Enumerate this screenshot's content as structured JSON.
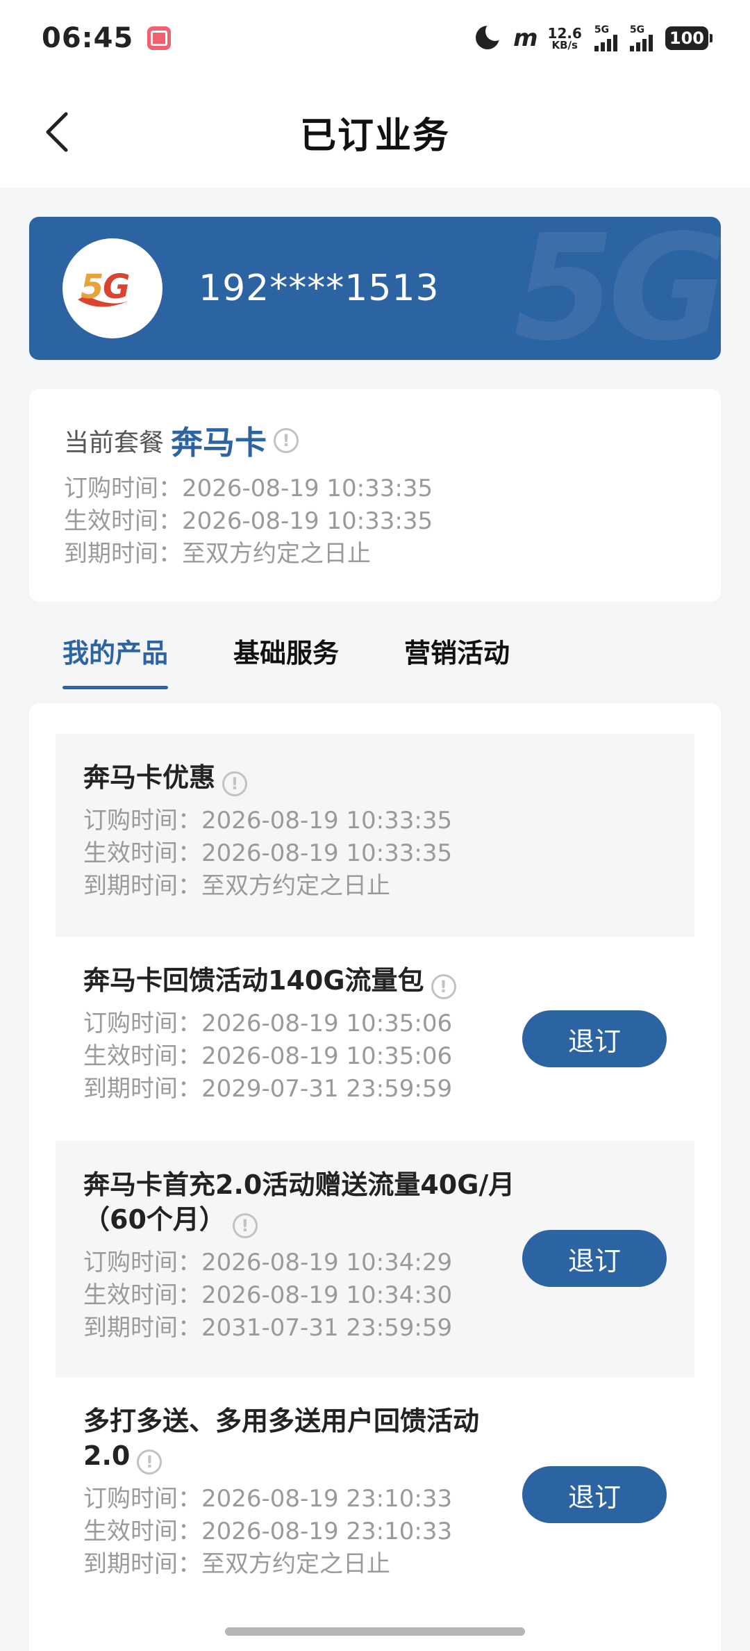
{
  "status_bar": {
    "time": "06:45",
    "net_speed_value": "12.6",
    "net_speed_unit": "KB/s",
    "sim1_tag": "5G",
    "sim2_tag": "5G",
    "battery": "100",
    "hd_label": "m"
  },
  "nav": {
    "title": "已订业务"
  },
  "account": {
    "phone_number": "192****1513",
    "logo_text": "5G",
    "watermark": "5G"
  },
  "current_plan": {
    "label": "当前套餐",
    "name": "奔马卡",
    "order_time": "订购时间：2026-08-19 10:33:35",
    "effective_time": "生效时间：2026-08-19 10:33:35",
    "expire_time": "到期时间：至双方约定之日止"
  },
  "tabs": [
    {
      "label": "我的产品",
      "active": true
    },
    {
      "label": "基础服务",
      "active": false
    },
    {
      "label": "营销活动",
      "active": false
    }
  ],
  "products": [
    {
      "title": "奔马卡优惠",
      "order_time": "订购时间：2026-08-19 10:33:35",
      "effective_time": "生效时间：2026-08-19 10:33:35",
      "expire_time": "到期时间：至双方约定之日止"
    },
    {
      "title": "奔马卡回馈活动140G流量包",
      "order_time": "订购时间：2026-08-19 10:35:06",
      "effective_time": "生效时间：2026-08-19 10:35:06",
      "expire_time": "到期时间：2029-07-31 23:59:59",
      "button": "退订"
    },
    {
      "title": "奔马卡首充2.0活动赠送流量40G/月（60个月）",
      "order_time": "订购时间：2026-08-19 10:34:29",
      "effective_time": "生效时间：2026-08-19 10:34:30",
      "expire_time": "到期时间：2031-07-31 23:59:59",
      "button": "退订"
    },
    {
      "title": "多打多送、多用多送用户回馈活动2.0",
      "order_time": "订购时间：2026-08-19 23:10:33",
      "effective_time": "生效时间：2026-08-19 23:10:33",
      "expire_time": "到期时间：至双方约定之日止",
      "button": "退订"
    }
  ],
  "info_glyph": "!",
  "colors": {
    "brand_blue": "#2c63a3",
    "logo_red": "#d9432f",
    "logo_orange": "#e8a23a",
    "text_gray": "#9a9a9a",
    "page_bg": "#f4f5f7"
  }
}
